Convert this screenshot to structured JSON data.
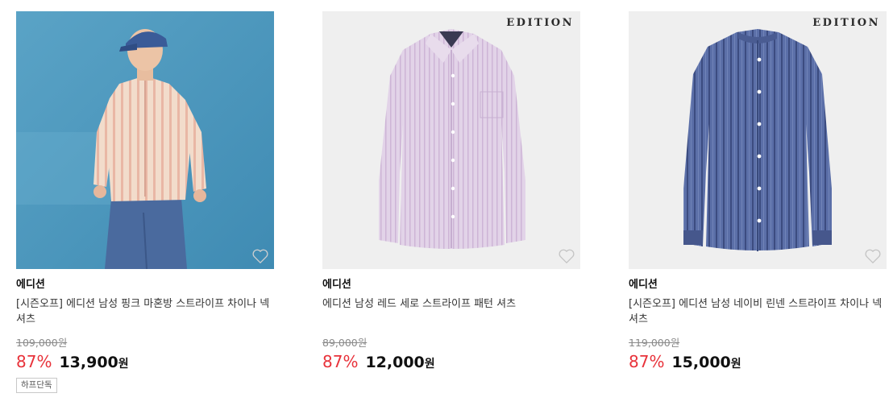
{
  "products": [
    {
      "brand": "에디션",
      "name": "[시즌오프] 에디션 남성 핑크 마혼방 스트라이프 차이나 넥 셔츠",
      "original_price": "109,000원",
      "discount": "87%",
      "price": "13,900",
      "currency": "원",
      "badge": "하프단독",
      "image": "model-wearing-pink-striped-shirt",
      "logo_text": ""
    },
    {
      "brand": "에디션",
      "name": "에디션 남성 레드 세로 스트라이프 패턴 셔츠",
      "original_price": "89,000원",
      "discount": "87%",
      "price": "12,000",
      "currency": "원",
      "badge": "",
      "image": "lavender-striped-dress-shirt",
      "logo_text": "EDITION"
    },
    {
      "brand": "에디션",
      "name": "[시즌오프] 에디션 남성 네이비 린넨 스트라이프 차이나 넥 셔츠",
      "original_price": "119,000원",
      "discount": "87%",
      "price": "15,000",
      "currency": "원",
      "badge": "",
      "image": "navy-striped-linen-shirt",
      "logo_text": "EDITION"
    }
  ],
  "colors": {
    "discount": "#e8323a",
    "text": "#111111",
    "strike": "#8a8a8a"
  },
  "icons": {
    "wishlist": "heart-outline-icon"
  }
}
